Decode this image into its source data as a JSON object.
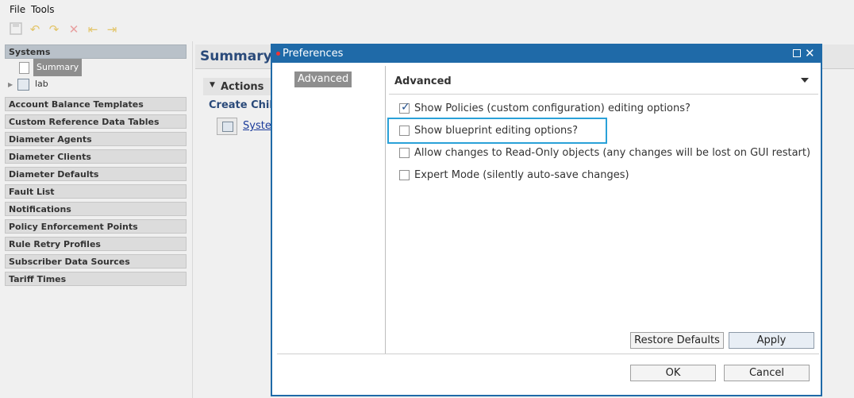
{
  "menu": {
    "file": "File",
    "tools": "Tools"
  },
  "toolbar": {
    "icons": [
      "save-icon",
      "undo-icon",
      "redo-icon",
      "delete-icon",
      "back-icon",
      "forward-icon"
    ]
  },
  "left": {
    "systems_header": "Systems",
    "tree": {
      "summary": "Summary",
      "lab": "lab"
    },
    "nav": [
      "Account Balance Templates",
      "Custom Reference Data Tables",
      "Diameter Agents",
      "Diameter Clients",
      "Diameter Defaults",
      "Fault List",
      "Notifications",
      "Policy Enforcement Points",
      "Rule Retry Profiles",
      "Subscriber Data Sources",
      "Tariff Times"
    ]
  },
  "main": {
    "title": "Summary",
    "actions_label": "Actions",
    "create_child": "Create Child",
    "system_link": "System"
  },
  "dialog": {
    "title": "Preferences",
    "nav_item": "Advanced",
    "page_title": "Advanced",
    "options": [
      {
        "label": "Show Policies (custom configuration) editing options?",
        "checked": true
      },
      {
        "label": "Show blueprint editing options?",
        "checked": false
      },
      {
        "label": "Allow changes to Read-Only objects (any changes will be lost on GUI restart)",
        "checked": false
      },
      {
        "label": "Expert Mode (silently auto-save changes)",
        "checked": false
      }
    ],
    "restore_defaults": "Restore Defaults",
    "apply": "Apply",
    "ok": "OK",
    "cancel": "Cancel"
  },
  "colors": {
    "accent": "#1f6aa8",
    "highlight": "#2aa1d8",
    "check": "#1f4e8c"
  }
}
